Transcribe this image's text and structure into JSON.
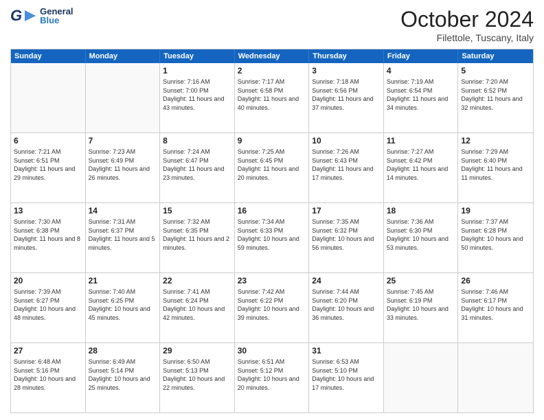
{
  "header": {
    "logo_general": "General",
    "logo_blue": "Blue",
    "month_title": "October 2024",
    "location": "Filettole, Tuscany, Italy"
  },
  "calendar": {
    "days_of_week": [
      "Sunday",
      "Monday",
      "Tuesday",
      "Wednesday",
      "Thursday",
      "Friday",
      "Saturday"
    ],
    "weeks": [
      [
        {
          "day": "",
          "detail": ""
        },
        {
          "day": "",
          "detail": ""
        },
        {
          "day": "1",
          "detail": "Sunrise: 7:16 AM\nSunset: 7:00 PM\nDaylight: 11 hours and 43 minutes."
        },
        {
          "day": "2",
          "detail": "Sunrise: 7:17 AM\nSunset: 6:58 PM\nDaylight: 11 hours and 40 minutes."
        },
        {
          "day": "3",
          "detail": "Sunrise: 7:18 AM\nSunset: 6:56 PM\nDaylight: 11 hours and 37 minutes."
        },
        {
          "day": "4",
          "detail": "Sunrise: 7:19 AM\nSunset: 6:54 PM\nDaylight: 11 hours and 34 minutes."
        },
        {
          "day": "5",
          "detail": "Sunrise: 7:20 AM\nSunset: 6:52 PM\nDaylight: 11 hours and 32 minutes."
        }
      ],
      [
        {
          "day": "6",
          "detail": "Sunrise: 7:21 AM\nSunset: 6:51 PM\nDaylight: 11 hours and 29 minutes."
        },
        {
          "day": "7",
          "detail": "Sunrise: 7:23 AM\nSunset: 6:49 PM\nDaylight: 11 hours and 26 minutes."
        },
        {
          "day": "8",
          "detail": "Sunrise: 7:24 AM\nSunset: 6:47 PM\nDaylight: 11 hours and 23 minutes."
        },
        {
          "day": "9",
          "detail": "Sunrise: 7:25 AM\nSunset: 6:45 PM\nDaylight: 11 hours and 20 minutes."
        },
        {
          "day": "10",
          "detail": "Sunrise: 7:26 AM\nSunset: 6:43 PM\nDaylight: 11 hours and 17 minutes."
        },
        {
          "day": "11",
          "detail": "Sunrise: 7:27 AM\nSunset: 6:42 PM\nDaylight: 11 hours and 14 minutes."
        },
        {
          "day": "12",
          "detail": "Sunrise: 7:29 AM\nSunset: 6:40 PM\nDaylight: 11 hours and 11 minutes."
        }
      ],
      [
        {
          "day": "13",
          "detail": "Sunrise: 7:30 AM\nSunset: 6:38 PM\nDaylight: 11 hours and 8 minutes."
        },
        {
          "day": "14",
          "detail": "Sunrise: 7:31 AM\nSunset: 6:37 PM\nDaylight: 11 hours and 5 minutes."
        },
        {
          "day": "15",
          "detail": "Sunrise: 7:32 AM\nSunset: 6:35 PM\nDaylight: 11 hours and 2 minutes."
        },
        {
          "day": "16",
          "detail": "Sunrise: 7:34 AM\nSunset: 6:33 PM\nDaylight: 10 hours and 59 minutes."
        },
        {
          "day": "17",
          "detail": "Sunrise: 7:35 AM\nSunset: 6:32 PM\nDaylight: 10 hours and 56 minutes."
        },
        {
          "day": "18",
          "detail": "Sunrise: 7:36 AM\nSunset: 6:30 PM\nDaylight: 10 hours and 53 minutes."
        },
        {
          "day": "19",
          "detail": "Sunrise: 7:37 AM\nSunset: 6:28 PM\nDaylight: 10 hours and 50 minutes."
        }
      ],
      [
        {
          "day": "20",
          "detail": "Sunrise: 7:39 AM\nSunset: 6:27 PM\nDaylight: 10 hours and 48 minutes."
        },
        {
          "day": "21",
          "detail": "Sunrise: 7:40 AM\nSunset: 6:25 PM\nDaylight: 10 hours and 45 minutes."
        },
        {
          "day": "22",
          "detail": "Sunrise: 7:41 AM\nSunset: 6:24 PM\nDaylight: 10 hours and 42 minutes."
        },
        {
          "day": "23",
          "detail": "Sunrise: 7:42 AM\nSunset: 6:22 PM\nDaylight: 10 hours and 39 minutes."
        },
        {
          "day": "24",
          "detail": "Sunrise: 7:44 AM\nSunset: 6:20 PM\nDaylight: 10 hours and 36 minutes."
        },
        {
          "day": "25",
          "detail": "Sunrise: 7:45 AM\nSunset: 6:19 PM\nDaylight: 10 hours and 33 minutes."
        },
        {
          "day": "26",
          "detail": "Sunrise: 7:46 AM\nSunset: 6:17 PM\nDaylight: 10 hours and 31 minutes."
        }
      ],
      [
        {
          "day": "27",
          "detail": "Sunrise: 6:48 AM\nSunset: 5:16 PM\nDaylight: 10 hours and 28 minutes."
        },
        {
          "day": "28",
          "detail": "Sunrise: 6:49 AM\nSunset: 5:14 PM\nDaylight: 10 hours and 25 minutes."
        },
        {
          "day": "29",
          "detail": "Sunrise: 6:50 AM\nSunset: 5:13 PM\nDaylight: 10 hours and 22 minutes."
        },
        {
          "day": "30",
          "detail": "Sunrise: 6:51 AM\nSunset: 5:12 PM\nDaylight: 10 hours and 20 minutes."
        },
        {
          "day": "31",
          "detail": "Sunrise: 6:53 AM\nSunset: 5:10 PM\nDaylight: 10 hours and 17 minutes."
        },
        {
          "day": "",
          "detail": ""
        },
        {
          "day": "",
          "detail": ""
        }
      ]
    ]
  }
}
